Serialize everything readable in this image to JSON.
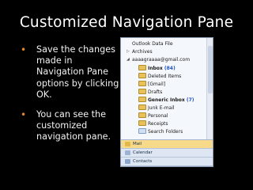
{
  "slide": {
    "title": "Customized Navigation Pane",
    "bullets": [
      "Save the changes made in Navigation Pane options by clicking OK.",
      "You can see the customized navigation pane."
    ]
  },
  "nav_pane": {
    "tree": {
      "outlook_data_file": "Outlook Data File",
      "archives": "Archives",
      "account": "aaaagraaaa@gmail.com",
      "inbox": "Inbox",
      "inbox_count": "(84)",
      "deleted_items": "Deleted Items",
      "gmail": "[Gmail]",
      "drafts": "Drafts",
      "generic_inbox": "Generic Inbox",
      "generic_inbox_count": "(7)",
      "junk_email": "Junk E-mail",
      "personal": "Personal",
      "receipts": "Receipts",
      "search_folders": "Search Folders"
    },
    "buttons": {
      "mail": "Mail",
      "calendar": "Calendar",
      "contacts": "Contacts"
    }
  },
  "colors": {
    "background": "#000000",
    "title": "#ffffff",
    "bullet": "#e08a2a",
    "selected_button": "#f7d98a"
  }
}
